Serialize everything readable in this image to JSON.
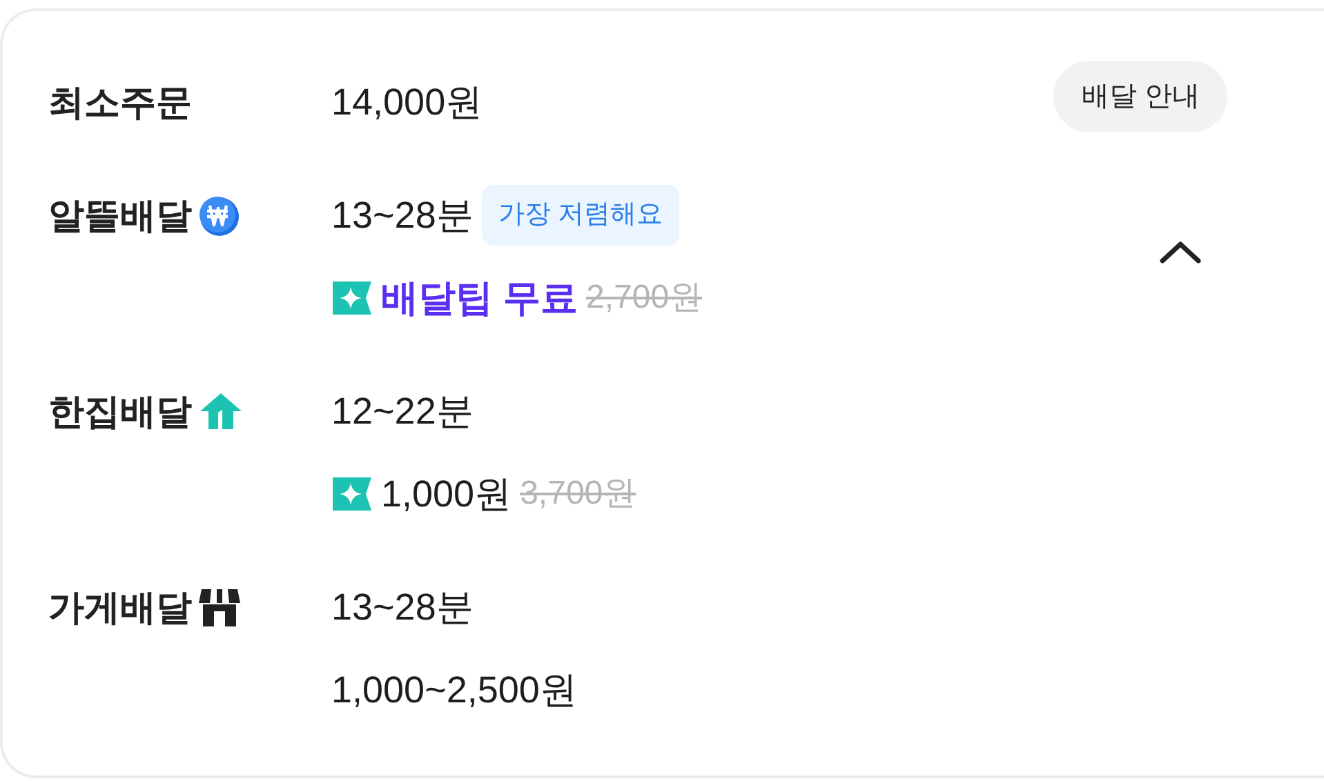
{
  "rows": [
    {
      "label": "최소주문",
      "kind": "minimum",
      "lines": [
        {
          "kind": "text",
          "text": "14,000원"
        }
      ],
      "action": {
        "kind": "button",
        "label": "배달 안내"
      }
    },
    {
      "label": "알뜰배달",
      "kind": "budget",
      "lines": [
        {
          "kind": "text",
          "text": "13~28분",
          "badge": "가장 저렴해요"
        },
        {
          "kind": "discount",
          "text": "배달팁 무료",
          "highlight": true,
          "original": "2,700원"
        }
      ],
      "action": {
        "kind": "chevron",
        "expanded": true
      }
    },
    {
      "label": "한집배달",
      "kind": "single",
      "lines": [
        {
          "kind": "text",
          "text": "12~22분"
        },
        {
          "kind": "discount",
          "text": "1,000원",
          "highlight": false,
          "original": "3,700원"
        }
      ]
    },
    {
      "label": "가게배달",
      "kind": "store",
      "lines": [
        {
          "kind": "text",
          "text": "13~28분"
        },
        {
          "kind": "text",
          "text": "1,000~2,500원"
        }
      ]
    }
  ]
}
